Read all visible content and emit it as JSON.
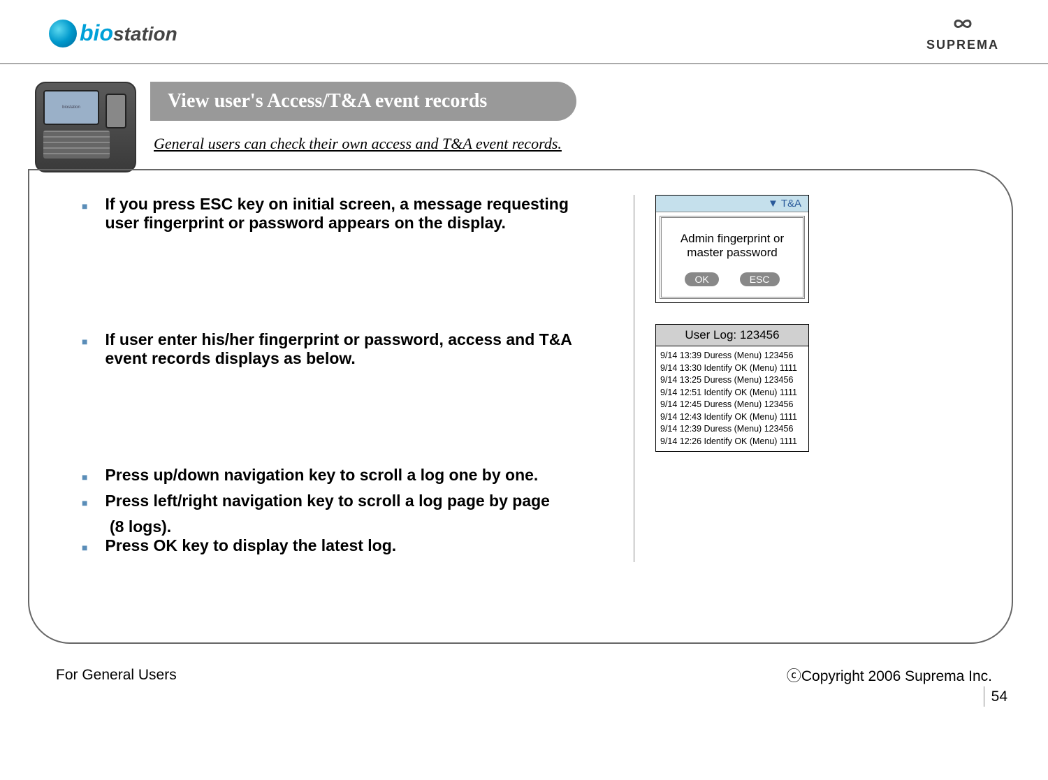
{
  "header": {
    "logo_left": "biostation",
    "logo_right": "SUPREMA"
  },
  "title": "View user's Access/T&A event records",
  "subtitle": "General users can check their own access and T&A event records.",
  "bullets": {
    "b1": "If you press ESC key on initial screen, a message requesting user fingerprint or password appears on the display.",
    "b2": "If user enter his/her fingerprint or password, access and T&A event records displays as below.",
    "b3": "Press up/down navigation key to scroll a log one by one.",
    "b4": "Press left/right navigation key to scroll a log page by page",
    "b4_cont": "(8 logs).",
    "b5": "Press OK key to display the latest log."
  },
  "screen1": {
    "header_tag": "T&A",
    "msg_line1": "Admin fingerprint or",
    "msg_line2": "master password",
    "ok": "OK",
    "esc": "ESC"
  },
  "screen2": {
    "title": "User Log: 123456",
    "rows": [
      "9/14 13:39 Duress (Menu) 123456",
      "9/14 13:30 Identify OK (Menu) 1111",
      "9/14 13:25 Duress (Menu) 123456",
      "9/14 12:51 Identify OK (Menu) 1111",
      "9/14 12:45 Duress (Menu) 123456",
      "9/14 12:43 Identify OK (Menu) 1111",
      "9/14 12:39 Duress (Menu) 123456",
      "9/14 12:26 Identify OK (Menu) 1111"
    ]
  },
  "footer": {
    "left": "For General Users",
    "right": "ⓒCopyright 2006 Suprema Inc.",
    "page": "54"
  }
}
